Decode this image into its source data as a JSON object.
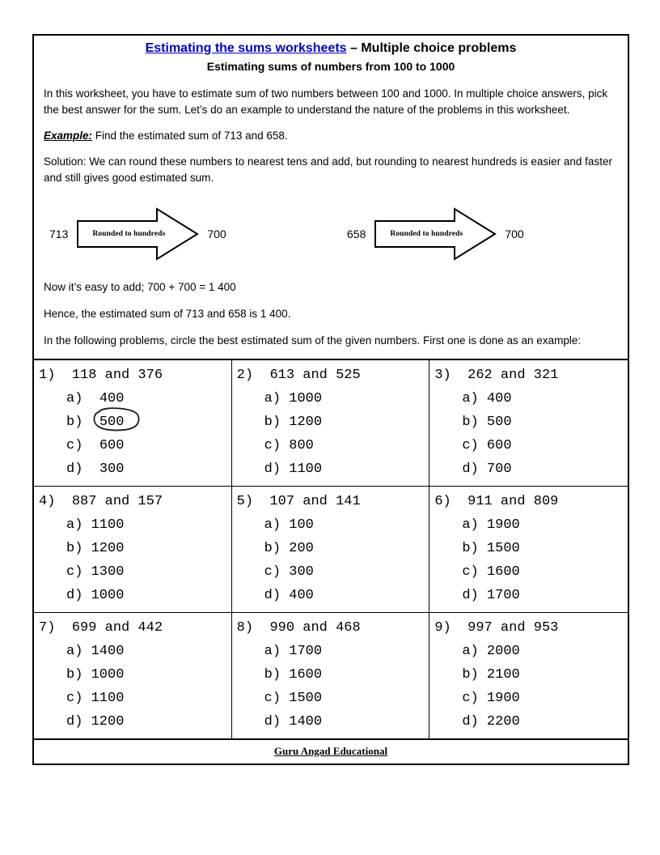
{
  "header": {
    "title_link": "Estimating the sums worksheets",
    "title_rest": " – Multiple choice problems",
    "subtitle": "Estimating sums of numbers from 100 to 1000"
  },
  "intro": {
    "paragraph": "In this worksheet, you have to estimate sum of two numbers between 100 and 1000. In multiple choice answers, pick the best answer for the sum. Let’s do an example to understand the nature of the problems in this worksheet.",
    "example_label": "Example:",
    "example_text": " Find the estimated sum of 713 and 658.",
    "solution": "Solution: We can round these numbers to nearest tens and add, but rounding to nearest hundreds is easier and faster and still gives good estimated sum.",
    "add_line": "Now it’s easy to add; 700 + 700 = 1 400",
    "hence_line": "Hence, the estimated sum of 713 and 658 is 1 400.",
    "instructions": "In the following problems, circle the best estimated sum of the given numbers. First one is done as an example:"
  },
  "diagram": {
    "left": {
      "from": "713",
      "arrow_label": "Rounded to hundreds",
      "to": "700"
    },
    "right": {
      "from": "658",
      "arrow_label": "Rounded to hundreds",
      "to": "700"
    }
  },
  "problems": [
    {
      "number": "1)",
      "question": "118 and 376",
      "options": [
        {
          "letter": "a)",
          "value": "400",
          "circled": false
        },
        {
          "letter": "b)",
          "value": "500",
          "circled": true
        },
        {
          "letter": "c)",
          "value": "600",
          "circled": false
        },
        {
          "letter": "d)",
          "value": "300",
          "circled": false
        }
      ]
    },
    {
      "number": "2)",
      "question": "613 and 525",
      "options": [
        {
          "letter": "a)",
          "value": "1000",
          "circled": false
        },
        {
          "letter": "b)",
          "value": "1200",
          "circled": false
        },
        {
          "letter": "c)",
          "value": "800",
          "circled": false
        },
        {
          "letter": "d)",
          "value": "1100",
          "circled": false
        }
      ]
    },
    {
      "number": "3)",
      "question": "262 and 321",
      "options": [
        {
          "letter": "a)",
          "value": "400",
          "circled": false
        },
        {
          "letter": "b)",
          "value": "500",
          "circled": false
        },
        {
          "letter": "c)",
          "value": "600",
          "circled": false
        },
        {
          "letter": "d)",
          "value": "700",
          "circled": false
        }
      ]
    },
    {
      "number": "4)",
      "question": "887 and 157",
      "options": [
        {
          "letter": "a)",
          "value": "1100",
          "circled": false
        },
        {
          "letter": "b)",
          "value": "1200",
          "circled": false
        },
        {
          "letter": "c)",
          "value": "1300",
          "circled": false
        },
        {
          "letter": "d)",
          "value": "1000",
          "circled": false
        }
      ]
    },
    {
      "number": "5)",
      "question": "107 and 141",
      "options": [
        {
          "letter": "a)",
          "value": "100",
          "circled": false
        },
        {
          "letter": "b)",
          "value": "200",
          "circled": false
        },
        {
          "letter": "c)",
          "value": "300",
          "circled": false
        },
        {
          "letter": "d)",
          "value": "400",
          "circled": false
        }
      ]
    },
    {
      "number": "6)",
      "question": "911 and 809",
      "options": [
        {
          "letter": "a)",
          "value": "1900",
          "circled": false
        },
        {
          "letter": "b)",
          "value": "1500",
          "circled": false
        },
        {
          "letter": "c)",
          "value": "1600",
          "circled": false
        },
        {
          "letter": "d)",
          "value": "1700",
          "circled": false
        }
      ]
    },
    {
      "number": "7)",
      "question": "699 and 442",
      "options": [
        {
          "letter": "a)",
          "value": "1400",
          "circled": false
        },
        {
          "letter": "b)",
          "value": "1000",
          "circled": false
        },
        {
          "letter": "c)",
          "value": "1100",
          "circled": false
        },
        {
          "letter": "d)",
          "value": "1200",
          "circled": false
        }
      ]
    },
    {
      "number": "8)",
      "question": "990 and 468",
      "options": [
        {
          "letter": "a)",
          "value": "1700",
          "circled": false
        },
        {
          "letter": "b)",
          "value": "1600",
          "circled": false
        },
        {
          "letter": "c)",
          "value": "1500",
          "circled": false
        },
        {
          "letter": "d)",
          "value": "1400",
          "circled": false
        }
      ]
    },
    {
      "number": "9)",
      "question": "997 and 953",
      "options": [
        {
          "letter": "a)",
          "value": "2000",
          "circled": false
        },
        {
          "letter": "b)",
          "value": "2100",
          "circled": false
        },
        {
          "letter": "c)",
          "value": "1900",
          "circled": false
        },
        {
          "letter": "d)",
          "value": "2200",
          "circled": false
        }
      ]
    }
  ],
  "footer": {
    "text": "Guru Angad Educational"
  },
  "colors": {
    "link": "#0000CC",
    "ink": "#000000",
    "paper": "#ffffff"
  }
}
